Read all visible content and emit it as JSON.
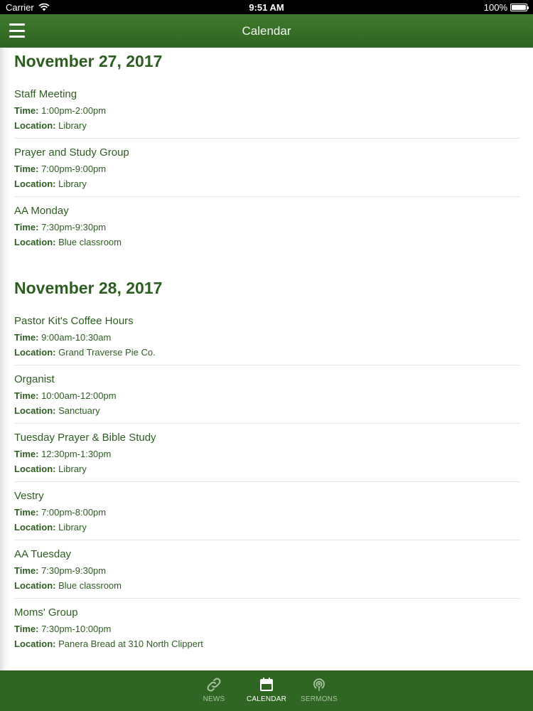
{
  "status_bar": {
    "carrier": "Carrier",
    "time": "9:51 AM",
    "battery": "100%"
  },
  "nav": {
    "title": "Calendar"
  },
  "labels": {
    "time": "Time:",
    "location": "Location:"
  },
  "days": [
    {
      "date": "November 27, 2017",
      "events": [
        {
          "title": "Staff Meeting",
          "time": "1:00pm-2:00pm",
          "location": "Library"
        },
        {
          "title": "Prayer and Study Group",
          "time": "7:00pm-9:00pm",
          "location": "Library"
        },
        {
          "title": "AA Monday",
          "time": "7:30pm-9:30pm",
          "location": "Blue classroom"
        }
      ]
    },
    {
      "date": "November 28, 2017",
      "events": [
        {
          "title": "Pastor Kit's Coffee Hours",
          "time": "9:00am-10:30am",
          "location": "Grand Traverse Pie Co."
        },
        {
          "title": "Organist",
          "time": "10:00am-12:00pm",
          "location": "Sanctuary"
        },
        {
          "title": "Tuesday Prayer & Bible Study",
          "time": "12:30pm-1:30pm",
          "location": "Library"
        },
        {
          "title": "Vestry",
          "time": "7:00pm-8:00pm",
          "location": "Library"
        },
        {
          "title": "AA Tuesday",
          "time": "7:30pm-9:30pm",
          "location": "Blue classroom"
        },
        {
          "title": "Moms' Group",
          "time": "7:30pm-10:00pm",
          "location": "Panera Bread at 310 North Clippert"
        }
      ]
    }
  ],
  "tabs": [
    {
      "label": "NEWS",
      "icon": "link-icon",
      "active": false
    },
    {
      "label": "CALENDAR",
      "icon": "calendar-icon",
      "active": true
    },
    {
      "label": "SERMONS",
      "icon": "podcast-icon",
      "active": false
    }
  ],
  "colors": {
    "nav": "#3a7429",
    "tab_bar": "#2f6623",
    "text_green": "#2e5d22"
  }
}
